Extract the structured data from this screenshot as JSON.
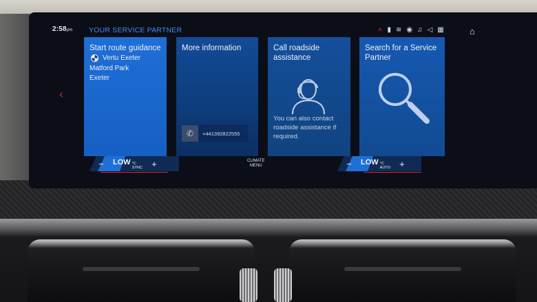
{
  "status_bar": {
    "time": "2:58",
    "time_suffix": "pm",
    "icons": [
      "navigation-arrow-icon",
      "media-icon",
      "connectivity-icon",
      "camera-icon",
      "music-icon",
      "volume-icon",
      "notification-icon"
    ]
  },
  "page": {
    "title": "YOUR SERVICE PARTNER"
  },
  "tiles": [
    {
      "title": "Start route guidance",
      "destination_name": "Vertu Exeter",
      "address_line1": "Matford Park",
      "address_line2": "Exeter"
    },
    {
      "title": "More information",
      "phone_number": "+441392822555"
    },
    {
      "title": "Call roadside assistance",
      "note": "You can also contact roadside assistance if required."
    },
    {
      "title": "Search for a Service Partner"
    }
  ],
  "climate": {
    "left": {
      "minus": "−",
      "temp": "LOW",
      "unit": "°C",
      "mode": "SYNC",
      "plus": "+"
    },
    "right": {
      "minus": "−",
      "temp": "LOW",
      "unit": "°C",
      "mode": "AUTO",
      "plus": "+"
    },
    "menu_line1": "CLIMATE",
    "menu_line2": "MENU"
  },
  "colors": {
    "accent_red": "#e0243c",
    "primary_blue": "#1f6fd6",
    "title_blue": "#3c8ef0"
  }
}
